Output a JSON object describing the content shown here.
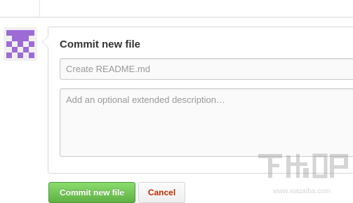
{
  "commit_form": {
    "title": "Commit new file",
    "summary_placeholder": "Create README.md",
    "description_placeholder": "Add an optional extended description…"
  },
  "actions": {
    "commit_label": "Commit new file",
    "cancel_label": "Cancel"
  },
  "avatar": {
    "icon": "identicon",
    "color": "#9d6bd6"
  },
  "watermark": {
    "text": "下载吧",
    "url": "www.xiazaiba.com"
  },
  "colors": {
    "commit_button": "#60b044",
    "cancel_text": "#bd2c00"
  }
}
